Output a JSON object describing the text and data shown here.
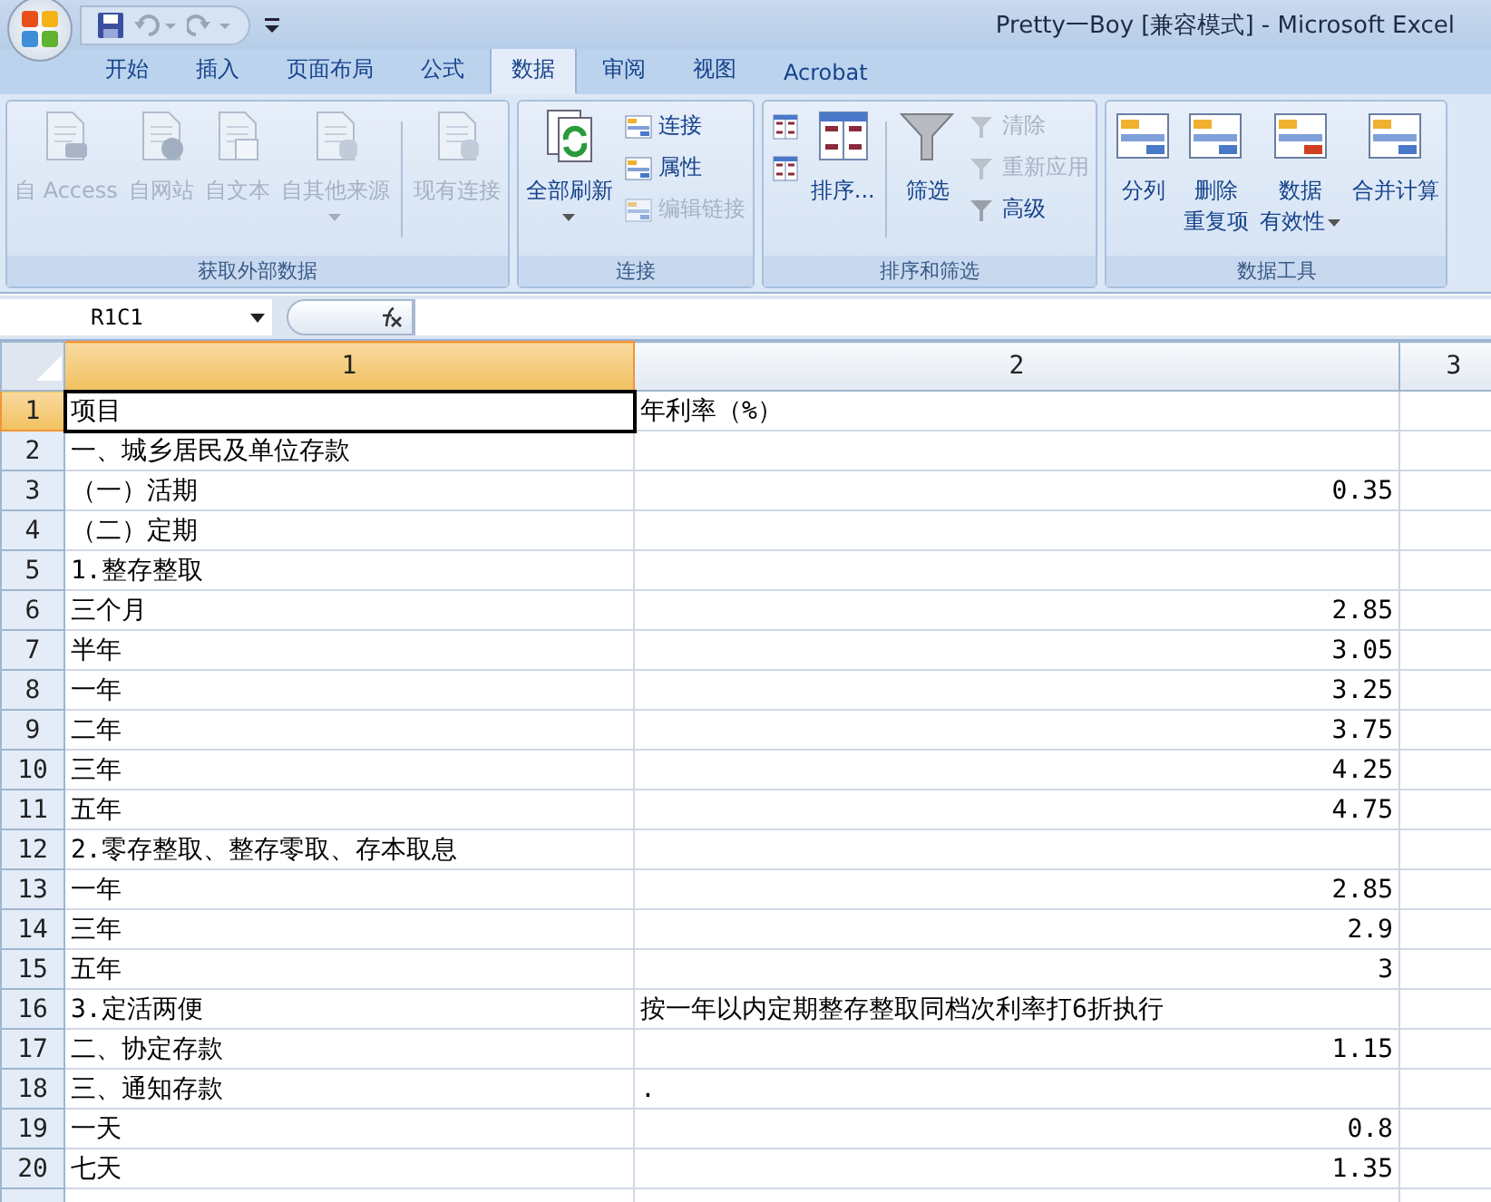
{
  "window": {
    "title": "Pretty一Boy  [兼容模式] - Microsoft Excel"
  },
  "ribbon": {
    "tabs": [
      {
        "label": "开始",
        "selected": false
      },
      {
        "label": "插入",
        "selected": false
      },
      {
        "label": "页面布局",
        "selected": false
      },
      {
        "label": "公式",
        "selected": false
      },
      {
        "label": "数据",
        "selected": true
      },
      {
        "label": "审阅",
        "selected": false
      },
      {
        "label": "视图",
        "selected": false
      },
      {
        "label": "Acrobat",
        "selected": false
      }
    ],
    "groups": [
      {
        "label": "获取外部数据",
        "columns": [
          {
            "kind": "large",
            "label": "自 Access",
            "disabled": true
          },
          {
            "kind": "large",
            "label": "自网站",
            "disabled": true
          },
          {
            "kind": "large",
            "label": "自文本",
            "disabled": true
          },
          {
            "kind": "large",
            "label": "自其他来源",
            "disabled": true,
            "dropdown": true
          },
          {
            "kind": "separator"
          },
          {
            "kind": "large",
            "label": "现有连接",
            "disabled": true
          }
        ]
      },
      {
        "label": "连接",
        "columns": [
          {
            "kind": "large",
            "label": "全部刷新",
            "disabled": false,
            "dropdown": true
          },
          {
            "kind": "stack",
            "items": [
              {
                "label": "连接",
                "disabled": false
              },
              {
                "label": "属性",
                "disabled": false
              },
              {
                "label": "编辑链接",
                "disabled": true
              }
            ]
          }
        ]
      },
      {
        "label": "排序和筛选",
        "columns": [
          {
            "kind": "stack",
            "items": [
              {
                "disabled": false
              },
              {
                "disabled": false
              }
            ]
          },
          {
            "kind": "large",
            "label": "排序...",
            "disabled": false
          },
          {
            "kind": "separator"
          },
          {
            "kind": "large",
            "label": "筛选",
            "disabled": false
          },
          {
            "kind": "stack",
            "items": [
              {
                "label": "清除",
                "disabled": true
              },
              {
                "label": "重新应用",
                "disabled": true
              },
              {
                "label": "高级",
                "disabled": false
              }
            ]
          }
        ]
      },
      {
        "label": "数据工具",
        "columns": [
          {
            "kind": "large",
            "label": "分列",
            "disabled": false
          },
          {
            "kind": "large",
            "label": "删除",
            "label2": "重复项",
            "disabled": false
          },
          {
            "kind": "large",
            "label": "数据",
            "label2": "有效性",
            "disabled": false,
            "dropdown": true
          },
          {
            "kind": "large",
            "label": "合并计算",
            "disabled": false
          }
        ]
      }
    ]
  },
  "formula_bar": {
    "name_box": "R1C1"
  },
  "sheet": {
    "columns": [
      {
        "label": "1",
        "selected": true
      },
      {
        "label": "2",
        "selected": false
      },
      {
        "label": "3",
        "selected": false
      }
    ],
    "rows": [
      {
        "label": "1",
        "selected": true,
        "cells": [
          {
            "text": "项目",
            "kind": "text"
          },
          {
            "text": "年利率（%）",
            "kind": "text"
          }
        ]
      },
      {
        "label": "2",
        "selected": false,
        "cells": [
          {
            "text": "一、城乡居民及单位存款",
            "kind": "text"
          }
        ]
      },
      {
        "label": "3",
        "selected": false,
        "cells": [
          {
            "text": "（一）活期",
            "kind": "text"
          },
          {
            "text": "0.35",
            "kind": "number"
          }
        ]
      },
      {
        "label": "4",
        "selected": false,
        "cells": [
          {
            "text": "（二）定期",
            "kind": "text"
          }
        ]
      },
      {
        "label": "5",
        "selected": false,
        "cells": [
          {
            "text": "1.整存整取",
            "kind": "text"
          }
        ]
      },
      {
        "label": "6",
        "selected": false,
        "cells": [
          {
            "text": "三个月",
            "kind": "text"
          },
          {
            "text": "2.85",
            "kind": "number"
          }
        ]
      },
      {
        "label": "7",
        "selected": false,
        "cells": [
          {
            "text": "半年",
            "kind": "text"
          },
          {
            "text": "3.05",
            "kind": "number"
          }
        ]
      },
      {
        "label": "8",
        "selected": false,
        "cells": [
          {
            "text": "一年",
            "kind": "text"
          },
          {
            "text": "3.25",
            "kind": "number"
          }
        ]
      },
      {
        "label": "9",
        "selected": false,
        "cells": [
          {
            "text": "二年",
            "kind": "text"
          },
          {
            "text": "3.75",
            "kind": "number"
          }
        ]
      },
      {
        "label": "10",
        "selected": false,
        "cells": [
          {
            "text": "三年",
            "kind": "text"
          },
          {
            "text": "4.25",
            "kind": "number"
          }
        ]
      },
      {
        "label": "11",
        "selected": false,
        "cells": [
          {
            "text": "五年",
            "kind": "text"
          },
          {
            "text": "4.75",
            "kind": "number"
          }
        ]
      },
      {
        "label": "12",
        "selected": false,
        "cells": [
          {
            "text": "2.零存整取、整存零取、存本取息",
            "kind": "text"
          }
        ]
      },
      {
        "label": "13",
        "selected": false,
        "cells": [
          {
            "text": "一年",
            "kind": "text"
          },
          {
            "text": "2.85",
            "kind": "number"
          }
        ]
      },
      {
        "label": "14",
        "selected": false,
        "cells": [
          {
            "text": "三年",
            "kind": "text"
          },
          {
            "text": "2.9",
            "kind": "number"
          }
        ]
      },
      {
        "label": "15",
        "selected": false,
        "cells": [
          {
            "text": "五年",
            "kind": "text"
          },
          {
            "text": "3",
            "kind": "number"
          }
        ]
      },
      {
        "label": "16",
        "selected": false,
        "cells": [
          {
            "text": "3.定活两便",
            "kind": "text"
          },
          {
            "text": "按一年以内定期整存整取同档次利率打6折执行",
            "kind": "text"
          }
        ]
      },
      {
        "label": "17",
        "selected": false,
        "cells": [
          {
            "text": "二、协定存款",
            "kind": "text"
          },
          {
            "text": "1.15",
            "kind": "number"
          }
        ]
      },
      {
        "label": "18",
        "selected": false,
        "cells": [
          {
            "text": "三、通知存款",
            "kind": "text"
          },
          {
            "text": ".",
            "kind": "text"
          }
        ]
      },
      {
        "label": "19",
        "selected": false,
        "cells": [
          {
            "text": "一天",
            "kind": "text"
          },
          {
            "text": "0.8",
            "kind": "number"
          }
        ]
      },
      {
        "label": "20",
        "selected": false,
        "cells": [
          {
            "text": "七天",
            "kind": "text"
          },
          {
            "text": "1.35",
            "kind": "number"
          }
        ]
      }
    ]
  }
}
